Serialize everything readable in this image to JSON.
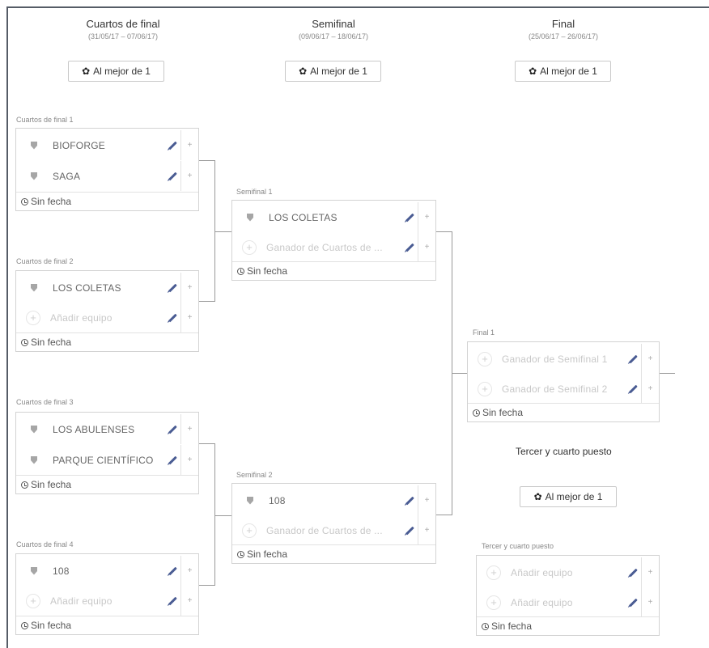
{
  "columns": [
    {
      "title": "Cuartos de final",
      "dates": "(31/05/17 – 07/06/17)",
      "button": "Al mejor de 1"
    },
    {
      "title": "Semifinal",
      "dates": "(09/06/17 – 18/06/17)",
      "button": "Al mejor de 1"
    },
    {
      "title": "Final",
      "dates": "(25/06/17 – 26/06/17)",
      "button": "Al mejor de 1"
    }
  ],
  "matches": {
    "qf1": {
      "label": "Cuartos de final 1",
      "team1": "BIOFORGE",
      "team2": "SAGA",
      "date": "Sin fecha"
    },
    "qf2": {
      "label": "Cuartos de final 2",
      "team1": "LOS COLETAS",
      "team2": "Añadir equipo",
      "date": "Sin fecha"
    },
    "qf3": {
      "label": "Cuartos de final 3",
      "team1": "LOS ABULENSES",
      "team2": "PARQUE CIENTÍFICO",
      "date": "Sin fecha"
    },
    "qf4": {
      "label": "Cuartos de final 4",
      "team1": "108",
      "team2": "Añadir equipo",
      "date": "Sin fecha"
    },
    "sf1": {
      "label": "Semifinal 1",
      "team1": "LOS COLETAS",
      "team2": "Ganador de Cuartos de ...",
      "date": "Sin fecha"
    },
    "sf2": {
      "label": "Semifinal 2",
      "team1": "108",
      "team2": "Ganador de Cuartos de ...",
      "date": "Sin fecha"
    },
    "f1": {
      "label": "Final 1",
      "team1": "Ganador de Semifinal 1",
      "team2": "Ganador de Semifinal 2",
      "date": "Sin fecha"
    },
    "third": {
      "label": "Tercer y cuarto puesto",
      "team1": "Añadir equipo",
      "team2": "Añadir equipo",
      "date": "Sin fecha"
    }
  },
  "third_place": {
    "title": "Tercer y cuarto puesto",
    "button": "Al mejor de 1"
  },
  "icons": {
    "gear": "gear-icon",
    "shield": "shield-icon",
    "pencil": "pencil-icon",
    "plus": "plus-icon",
    "clock": "clock-icon"
  },
  "plus_symbol": "+"
}
